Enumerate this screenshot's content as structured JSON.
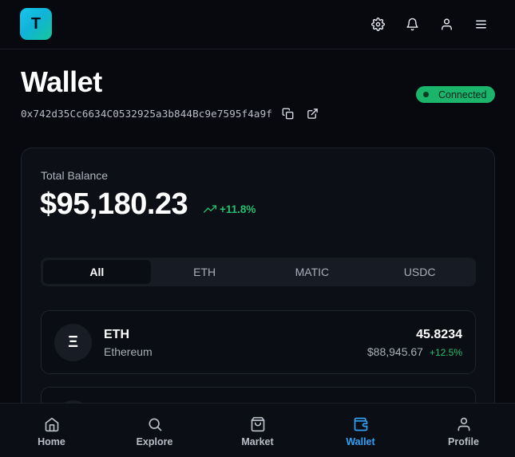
{
  "header": {
    "logo_letter": "T",
    "icons": [
      "gear-icon",
      "bell-icon",
      "user-icon",
      "menu-icon"
    ]
  },
  "wallet": {
    "title": "Wallet",
    "address": "0x742d35Cc6634C0532925a3b844Bc9e7595f4a9f",
    "status": "Connected",
    "status_color": "#1bb46b"
  },
  "balance": {
    "label": "Total Balance",
    "value": "$95,180.23",
    "change": "+11.8%",
    "change_color": "#22c06e"
  },
  "tabs": [
    {
      "label": "All",
      "active": true
    },
    {
      "label": "ETH",
      "active": false
    },
    {
      "label": "MATIC",
      "active": false
    },
    {
      "label": "USDC",
      "active": false
    }
  ],
  "tokens": [
    {
      "icon_glyph": "Ξ",
      "symbol": "ETH",
      "name": "Ethereum",
      "amount": "45.8234",
      "usd_value": "$88,945.67",
      "change": "+12.5%"
    }
  ],
  "bottom_nav": [
    {
      "label": "Home",
      "icon": "home-icon",
      "active": false
    },
    {
      "label": "Explore",
      "icon": "search-icon",
      "active": false
    },
    {
      "label": "Market",
      "icon": "shopping-bag-icon",
      "active": false
    },
    {
      "label": "Wallet",
      "icon": "wallet-icon",
      "active": true
    },
    {
      "label": "Profile",
      "icon": "user-icon",
      "active": false
    }
  ],
  "accent_color": "#2ea2f5"
}
